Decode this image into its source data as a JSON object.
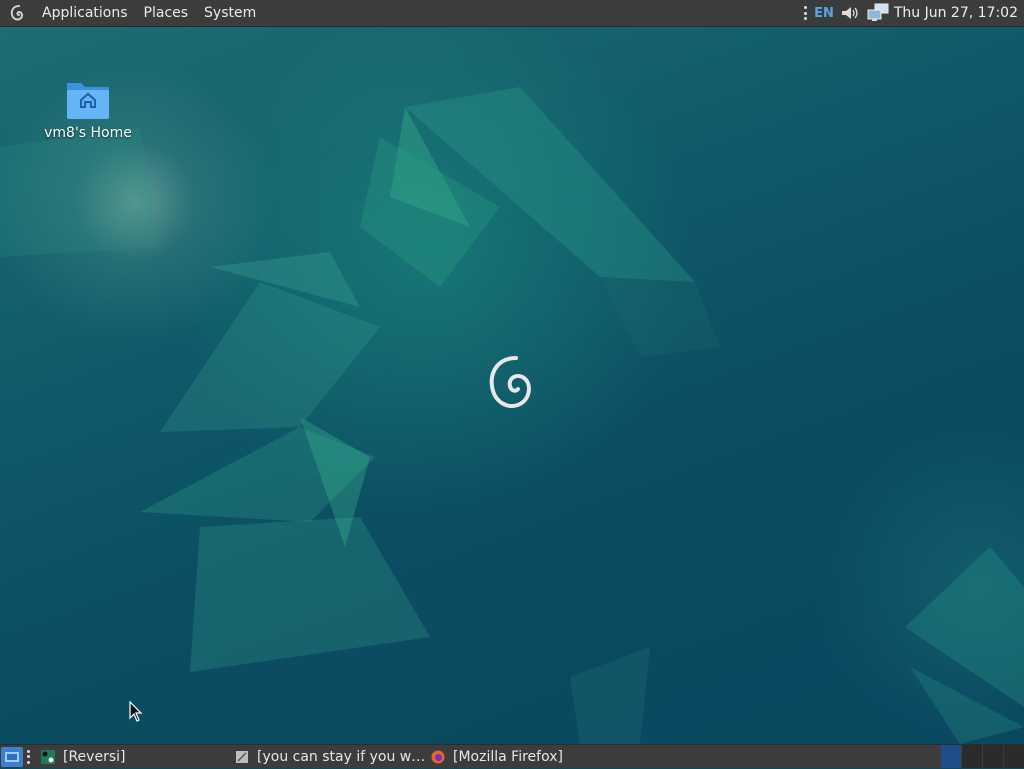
{
  "top_panel": {
    "menus": [
      "Applications",
      "Places",
      "System"
    ],
    "language": "EN",
    "clock": "Thu Jun 27, 17:02",
    "icons": [
      "debian-logo-icon",
      "overflow-dots-icon",
      "volume-icon",
      "network-icon"
    ]
  },
  "desktop": {
    "home_folder_label": "vm8's Home",
    "colors": {
      "background": "#0c4a5e",
      "accent": "#1d6d72"
    }
  },
  "taskbar": {
    "tasks": [
      {
        "label": "[Reversi]",
        "icon": "reversi-icon"
      },
      {
        "label": "[you can stay if you w…",
        "icon": "text-editor-icon"
      },
      {
        "label": "[Mozilla Firefox]",
        "icon": "firefox-icon"
      }
    ],
    "workspaces": 4,
    "active_workspace": 1
  }
}
